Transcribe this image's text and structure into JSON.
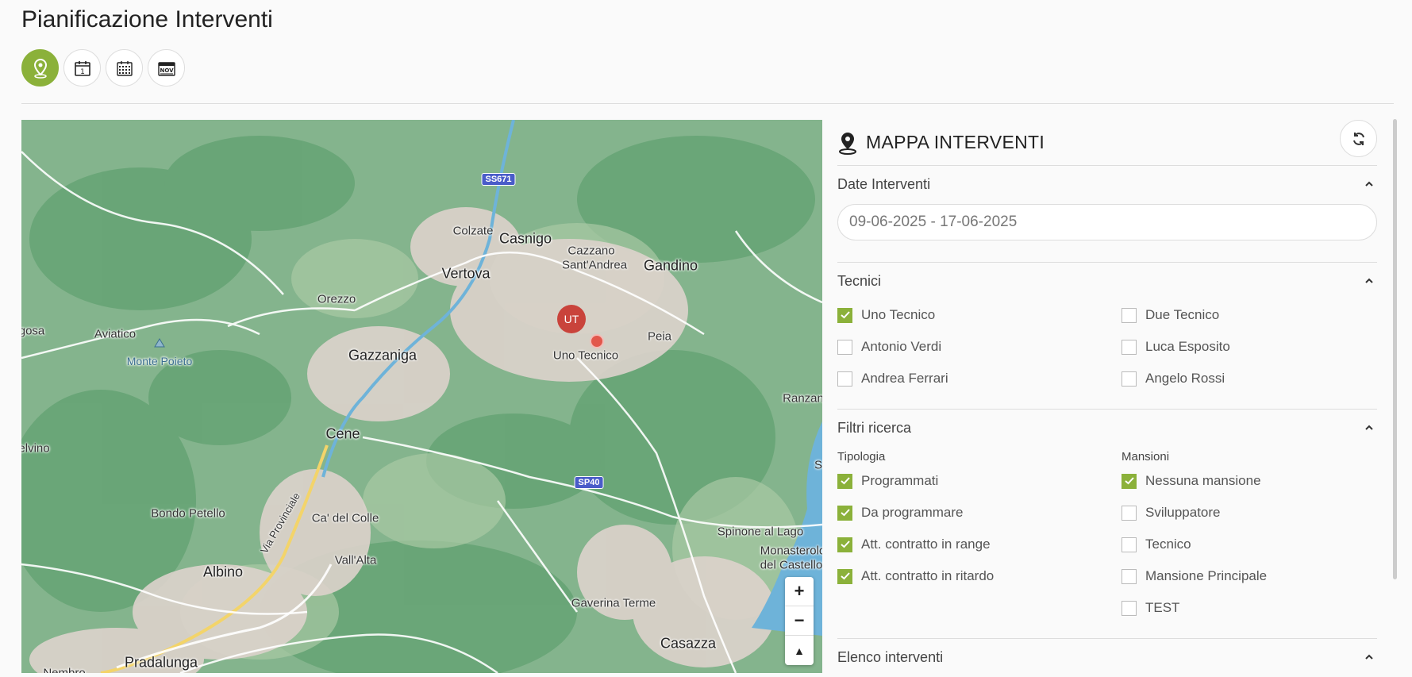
{
  "page": {
    "title": "Pianificazione Interventi"
  },
  "views": [
    {
      "name": "map-view",
      "icon": "map-pin-icon",
      "active": true
    },
    {
      "name": "day-view",
      "icon": "calendar-day-icon",
      "active": false
    },
    {
      "name": "month-view",
      "icon": "calendar-grid-icon",
      "active": false
    },
    {
      "name": "year-view",
      "icon": "calendar-month-icon",
      "active": false
    }
  ],
  "colors": {
    "accent": "#8bb13a",
    "marker": "#c9433b"
  },
  "map": {
    "places": [
      {
        "text": "Colzate",
        "size": "normal"
      },
      {
        "text": "Casnigo",
        "size": "big"
      },
      {
        "text": "Cazzano",
        "size": "normal"
      },
      {
        "text": "Sant'Andrea",
        "size": "normal"
      },
      {
        "text": "Gandino",
        "size": "big"
      },
      {
        "text": "Vertova",
        "size": "big"
      },
      {
        "text": "Orezzo",
        "size": "normal"
      },
      {
        "text": "Aviatico",
        "size": "normal"
      },
      {
        "text": "gosa",
        "size": "normal"
      },
      {
        "text": "Monte Poieto",
        "size": "peak"
      },
      {
        "text": "Gazzaniga",
        "size": "big"
      },
      {
        "text": "Peia",
        "size": "normal"
      },
      {
        "text": "Uno Tecnico",
        "size": "normal"
      },
      {
        "text": "Ranzan",
        "size": "normal"
      },
      {
        "text": "Cene",
        "size": "big"
      },
      {
        "text": "elvino",
        "size": "normal"
      },
      {
        "text": "Bondo Petello",
        "size": "normal"
      },
      {
        "text": "Ca' del Colle",
        "size": "normal"
      },
      {
        "text": "Via Provinciale",
        "size": "small"
      },
      {
        "text": "Spinone al Lago",
        "size": "normal"
      },
      {
        "text": "Monasterolo",
        "size": "normal"
      },
      {
        "text": "del Castello",
        "size": "normal"
      },
      {
        "text": "Vall'Alta",
        "size": "normal"
      },
      {
        "text": "Albino",
        "size": "big"
      },
      {
        "text": "Gaverina Terme",
        "size": "normal"
      },
      {
        "text": "Casazza",
        "size": "big"
      },
      {
        "text": "Pradalunga",
        "size": "big"
      },
      {
        "text": "Nembro",
        "size": "normal"
      },
      {
        "text": "S",
        "size": "normal"
      }
    ],
    "roads": [
      "SS671",
      "SP40"
    ],
    "marker": {
      "initials": "UT"
    },
    "zoom": {
      "in": "+",
      "out": "−",
      "north": "▲"
    }
  },
  "panel": {
    "title": "MAPPA INTERVENTI",
    "dates": {
      "label": "Date Interventi",
      "value": "09-06-2025 - 17-06-2025"
    },
    "tecnici": {
      "label": "Tecnici",
      "items": [
        {
          "label": "Uno Tecnico",
          "checked": true
        },
        {
          "label": "Due Tecnico",
          "checked": false
        },
        {
          "label": "Antonio Verdi",
          "checked": false
        },
        {
          "label": "Luca Esposito",
          "checked": false
        },
        {
          "label": "Andrea Ferrari",
          "checked": false
        },
        {
          "label": "Angelo Rossi",
          "checked": false
        }
      ]
    },
    "filtri": {
      "label": "Filtri ricerca",
      "tipologia": {
        "label": "Tipologia",
        "items": [
          {
            "label": "Programmati",
            "checked": true
          },
          {
            "label": "Da programmare",
            "checked": true
          },
          {
            "label": "Att. contratto in range",
            "checked": true
          },
          {
            "label": "Att. contratto in ritardo",
            "checked": true
          }
        ]
      },
      "mansioni": {
        "label": "Mansioni",
        "items": [
          {
            "label": "Nessuna mansione",
            "checked": true
          },
          {
            "label": "Sviluppatore",
            "checked": false
          },
          {
            "label": "Tecnico",
            "checked": false
          },
          {
            "label": "Mansione Principale",
            "checked": false
          },
          {
            "label": "TEST",
            "checked": false
          }
        ]
      }
    },
    "elenco": {
      "label": "Elenco interventi"
    }
  }
}
